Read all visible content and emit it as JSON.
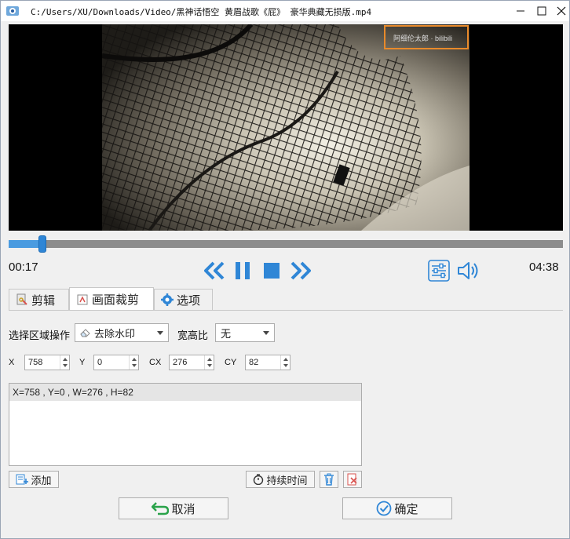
{
  "window": {
    "title": "C:/Users/XU/Downloads/Video/黑神话悟空 黄眉战歌《屁》 豪华典藏无损版.mp4",
    "minimize_icon": "minimize-icon",
    "maximize_icon": "maximize-icon",
    "close_icon": "close-icon"
  },
  "video": {
    "watermark_text": "阿细伦太郎 · bilibili",
    "watermark_border_color": "#e98a2a"
  },
  "player": {
    "current_time": "00:17",
    "total_time": "04:38",
    "progress": 0.061,
    "accent_color": "#2f86d6",
    "controls": [
      "rewind-icon",
      "pause-icon",
      "stop-icon",
      "fast-forward-icon",
      "equalizer-icon",
      "volume-icon"
    ]
  },
  "tabs": [
    {
      "label": "剪辑",
      "icon": "clip-icon"
    },
    {
      "label": "画面裁剪",
      "icon": "crop-icon",
      "active": true
    },
    {
      "label": "选项",
      "icon": "gear-icon"
    }
  ],
  "crop": {
    "operation_label": "选择区域操作",
    "operation_value": "去除水印",
    "aspect_label": "宽高比",
    "aspect_value": "无",
    "x_label": "X",
    "x_value": "758",
    "y_label": "Y",
    "y_value": "0",
    "cx_label": "CX",
    "cx_value": "276",
    "cy_label": "CY",
    "cy_value": "82",
    "regions": [
      "X=758 , Y=0 , W=276 , H=82"
    ]
  },
  "actions": {
    "add_label": "添加",
    "duration_label": "持续时间",
    "delete_icon": "trash-icon",
    "clear_icon": "clear-icon"
  },
  "footer": {
    "cancel_label": "取消",
    "ok_label": "确定"
  }
}
